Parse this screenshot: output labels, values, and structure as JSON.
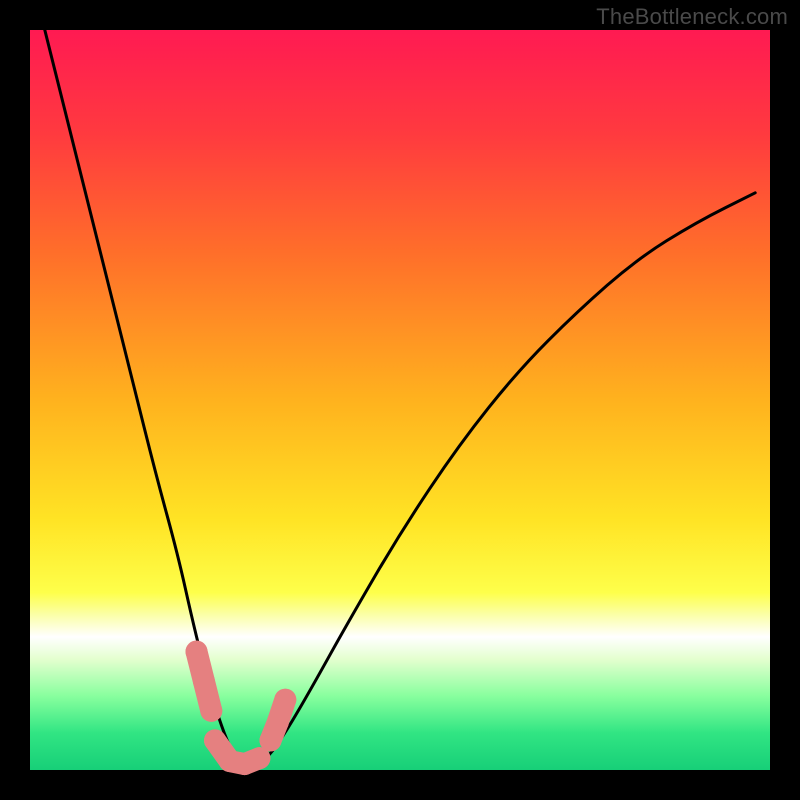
{
  "watermark": "TheBottleneck.com",
  "gradient": {
    "stops": [
      {
        "pct": 0,
        "color": "#ff1a52"
      },
      {
        "pct": 14,
        "color": "#ff3a3f"
      },
      {
        "pct": 30,
        "color": "#ff6e2a"
      },
      {
        "pct": 50,
        "color": "#ffb21e"
      },
      {
        "pct": 66,
        "color": "#ffe324"
      },
      {
        "pct": 76,
        "color": "#feff4a"
      },
      {
        "pct": 79,
        "color": "#fbffa6"
      },
      {
        "pct": 82,
        "color": "#ffffff"
      },
      {
        "pct": 85,
        "color": "#e4ffcf"
      },
      {
        "pct": 90,
        "color": "#88ff9e"
      },
      {
        "pct": 95,
        "color": "#31e583"
      },
      {
        "pct": 100,
        "color": "#17cf78"
      }
    ]
  },
  "highlight_color": "#e58080",
  "curve_color": "#000000",
  "chart_data": {
    "type": "line",
    "title": "",
    "xlabel": "",
    "ylabel": "",
    "xlim": [
      0,
      100
    ],
    "ylim": [
      0,
      100
    ],
    "series": [
      {
        "name": "bottleneck-curve",
        "x": [
          2,
          5,
          8,
          11,
          14,
          17,
          20,
          22,
          24,
          25.5,
          27,
          28.5,
          30,
          32,
          34.5,
          38,
          43,
          50,
          58,
          66,
          74,
          82,
          90,
          98
        ],
        "y": [
          100,
          88,
          76,
          64,
          52,
          40,
          29,
          20,
          12,
          7,
          3,
          1,
          0.5,
          1.5,
          5,
          11,
          20,
          32,
          44,
          54,
          62,
          69,
          74,
          78
        ]
      }
    ],
    "highlight_segments": [
      {
        "x": [
          22.5,
          23.5,
          24.5
        ],
        "y": [
          16,
          12,
          8
        ]
      },
      {
        "x": [
          25,
          27,
          29,
          31
        ],
        "y": [
          4,
          1.2,
          0.8,
          1.6
        ]
      },
      {
        "x": [
          32.5,
          33.5,
          34.5
        ],
        "y": [
          4,
          6.5,
          9.5
        ]
      }
    ],
    "min_point": {
      "x": 29,
      "y": 0.5
    }
  }
}
